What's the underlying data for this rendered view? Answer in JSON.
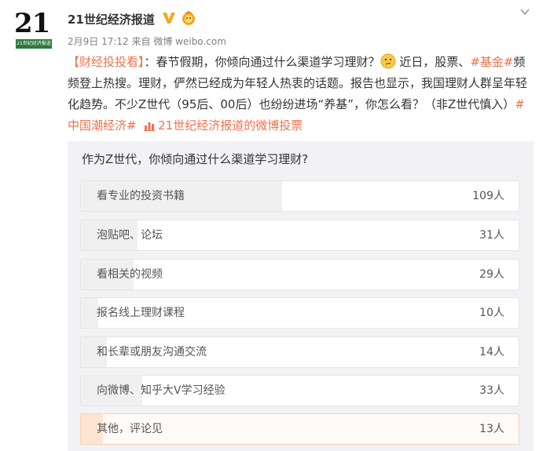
{
  "header": {
    "avatar_number": "21",
    "avatar_caption": "21世纪经济报道",
    "name": "21世纪经济报道",
    "date": "2月9日",
    "time": "17:12",
    "source": "来自 微博 weibo.com"
  },
  "post": {
    "bracket_open": "【",
    "topic_tag": "财经投投看",
    "bracket_close": "】",
    "text1": "：春节假期，你倾向通过什么渠道学习理财？",
    "text2": "近日，股票、",
    "hashtag1": "#基金#",
    "text3": "频频登上热搜。理财，俨然已经成为年轻人热衷的话题。报告也显示，我国理财人群呈年轻化趋势。不少Z世代（95后、00后）也纷纷进场“养基”，你怎么看？（非Z世代慎入）",
    "hashtag2": "#中国潮经济#",
    "poll_link": "21世纪经济报道的微博投票"
  },
  "poll": {
    "question": "作为Z世代，你倾向通过什么渠道学习理财?",
    "options": [
      {
        "label": "看专业的投资书籍",
        "count": "109人",
        "share": 0.46,
        "selected": false
      },
      {
        "label": "泡贴吧、论坛",
        "count": "31人",
        "share": 0.13,
        "selected": false
      },
      {
        "label": "看相关的视频",
        "count": "29人",
        "share": 0.12,
        "selected": false
      },
      {
        "label": "报名线上理财课程",
        "count": "10人",
        "share": 0.04,
        "selected": false
      },
      {
        "label": "和长辈或朋友沟通交流",
        "count": "14人",
        "share": 0.06,
        "selected": false
      },
      {
        "label": "向微博、知乎大V学习经验",
        "count": "33人",
        "share": 0.14,
        "selected": false
      },
      {
        "label": "其他，评论见",
        "count": "13人",
        "share": 0.05,
        "selected": true
      }
    ]
  },
  "colors": {
    "accent": "#eb7350",
    "badge": "#f6a623",
    "avatar_green": "#2b7a3a"
  },
  "icons": {
    "verified": "v-verified-icon",
    "emoji": "thinking-emoji-icon",
    "poll": "poll-chart-icon",
    "menu": "chevron-down-icon"
  }
}
